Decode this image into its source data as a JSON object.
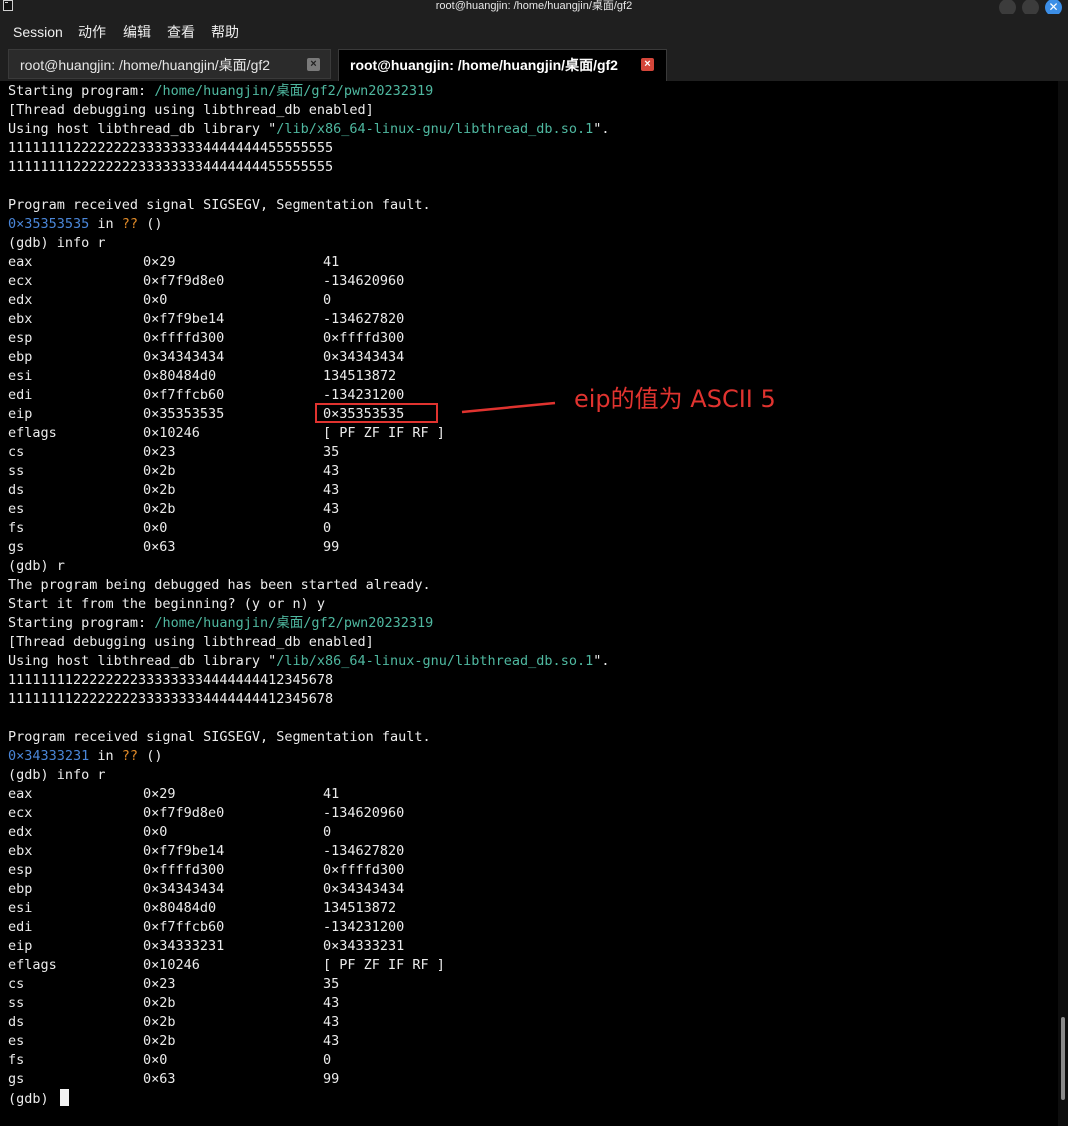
{
  "window": {
    "title": "root@huangjin: /home/huangjin/桌面/gf2"
  },
  "menu": [
    "Session",
    "动作",
    "编辑",
    "查看",
    "帮助"
  ],
  "tabs": [
    {
      "label": "root@huangjin: /home/huangjin/桌面/gf2",
      "close": "×"
    },
    {
      "label": "root@huangjin: /home/huangjin/桌面/gf2",
      "close": "×"
    }
  ],
  "run1": {
    "start_prefix": "Starting program: ",
    "start_path": "/home/huangjin/桌面/gf2/pwn20232319",
    "thread_msg": "[Thread debugging using libthread_db enabled]",
    "lib_prefix": "Using host libthread_db library \"",
    "lib_path": "/lib/x86_64-linux-gnu/libthread_db.so.1",
    "lib_suffix": "\".",
    "output1": "1111111122222222333333334444444455555555",
    "output2": "1111111122222222333333334444444455555555",
    "signal_msg": "Program received signal SIGSEGV, Segmentation fault.",
    "crash_addr": "0×35353535",
    "crash_in": " in ",
    "crash_qq": "??",
    "crash_paren": " ()",
    "cmd": "(gdb) info r",
    "registers": [
      {
        "name": "eax",
        "hex": "0×29",
        "val": "41"
      },
      {
        "name": "ecx",
        "hex": "0×f7f9d8e0",
        "val": "-134620960"
      },
      {
        "name": "edx",
        "hex": "0×0",
        "val": "0"
      },
      {
        "name": "ebx",
        "hex": "0×f7f9be14",
        "val": "-134627820"
      },
      {
        "name": "esp",
        "hex": "0×ffffd300",
        "val": "0×ffffd300"
      },
      {
        "name": "ebp",
        "hex": "0×34343434",
        "val": "0×34343434"
      },
      {
        "name": "esi",
        "hex": "0×80484d0",
        "val": "134513872"
      },
      {
        "name": "edi",
        "hex": "0×f7ffcb60",
        "val": "-134231200"
      },
      {
        "name": "eip",
        "hex": "0×35353535",
        "val": "0×35353535"
      },
      {
        "name": "eflags",
        "hex": "0×10246",
        "val": "[ PF ZF IF RF ]"
      },
      {
        "name": "cs",
        "hex": "0×23",
        "val": "35"
      },
      {
        "name": "ss",
        "hex": "0×2b",
        "val": "43"
      },
      {
        "name": "ds",
        "hex": "0×2b",
        "val": "43"
      },
      {
        "name": "es",
        "hex": "0×2b",
        "val": "43"
      },
      {
        "name": "fs",
        "hex": "0×0",
        "val": "0"
      },
      {
        "name": "gs",
        "hex": "0×63",
        "val": "99"
      }
    ]
  },
  "restart": {
    "cmd": "(gdb) r",
    "msg1": "The program being debugged has been started already.",
    "msg2": "Start it from the beginning? (y or n) y"
  },
  "run2": {
    "start_prefix": "Starting program: ",
    "start_path": "/home/huangjin/桌面/gf2/pwn20232319",
    "thread_msg": "[Thread debugging using libthread_db enabled]",
    "lib_prefix": "Using host libthread_db library \"",
    "lib_path": "/lib/x86_64-linux-gnu/libthread_db.so.1",
    "lib_suffix": "\".",
    "output1": "1111111122222222333333334444444412345678",
    "output2": "1111111122222222333333334444444412345678",
    "signal_msg": "Program received signal SIGSEGV, Segmentation fault.",
    "crash_addr": "0×34333231",
    "crash_in": " in ",
    "crash_qq": "??",
    "crash_paren": " ()",
    "cmd": "(gdb) info r",
    "registers": [
      {
        "name": "eax",
        "hex": "0×29",
        "val": "41"
      },
      {
        "name": "ecx",
        "hex": "0×f7f9d8e0",
        "val": "-134620960"
      },
      {
        "name": "edx",
        "hex": "0×0",
        "val": "0"
      },
      {
        "name": "ebx",
        "hex": "0×f7f9be14",
        "val": "-134627820"
      },
      {
        "name": "esp",
        "hex": "0×ffffd300",
        "val": "0×ffffd300"
      },
      {
        "name": "ebp",
        "hex": "0×34343434",
        "val": "0×34343434"
      },
      {
        "name": "esi",
        "hex": "0×80484d0",
        "val": "134513872"
      },
      {
        "name": "edi",
        "hex": "0×f7ffcb60",
        "val": "-134231200"
      },
      {
        "name": "eip",
        "hex": "0×34333231",
        "val": "0×34333231"
      },
      {
        "name": "eflags",
        "hex": "0×10246",
        "val": "[ PF ZF IF RF ]"
      },
      {
        "name": "cs",
        "hex": "0×23",
        "val": "35"
      },
      {
        "name": "ss",
        "hex": "0×2b",
        "val": "43"
      },
      {
        "name": "ds",
        "hex": "0×2b",
        "val": "43"
      },
      {
        "name": "es",
        "hex": "0×2b",
        "val": "43"
      },
      {
        "name": "fs",
        "hex": "0×0",
        "val": "0"
      },
      {
        "name": "gs",
        "hex": "0×63",
        "val": "99"
      }
    ]
  },
  "prompt": "(gdb) ",
  "annotation": {
    "text": "eip的值为 ASCII 5",
    "color": "#e0332f"
  },
  "colors": {
    "path": "#4fb8a0",
    "address": "#4a86d8",
    "unknown": "#e08a28",
    "text": "#ececec",
    "background": "#000000"
  }
}
